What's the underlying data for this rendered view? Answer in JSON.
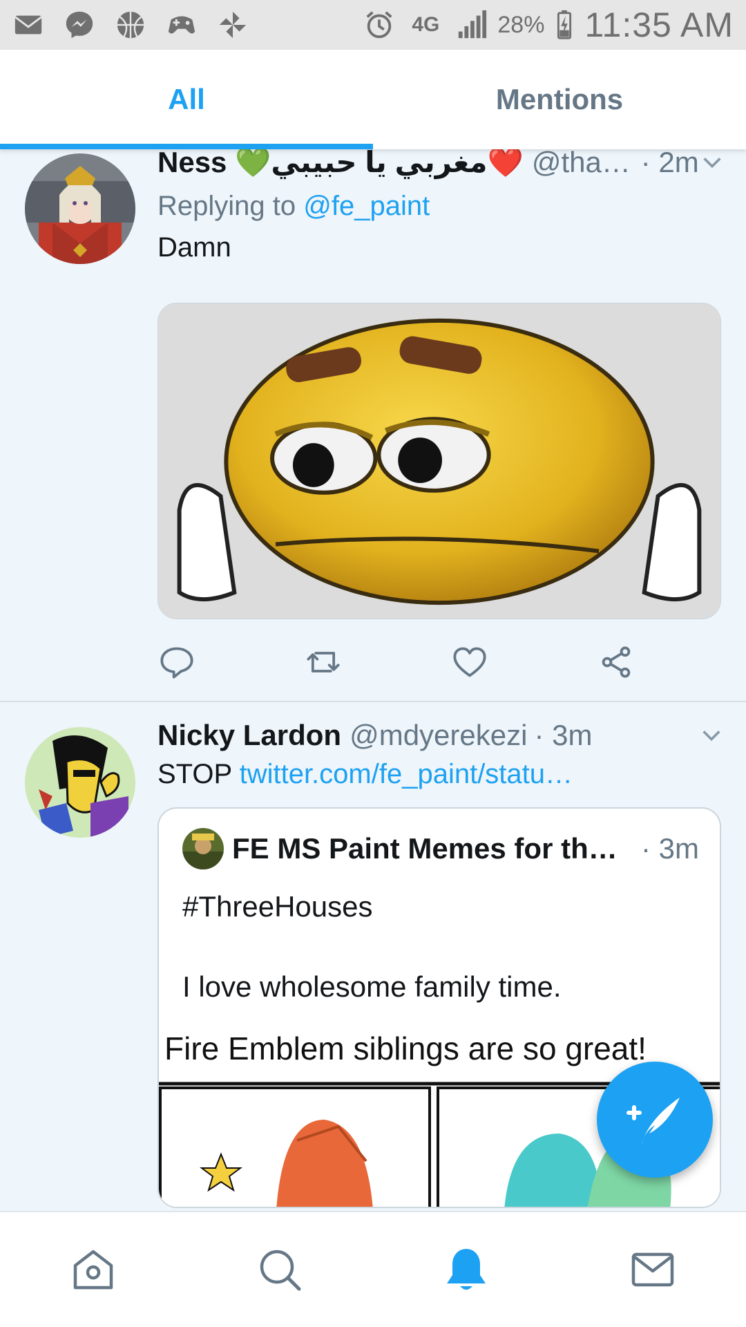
{
  "status_bar": {
    "left_icons": [
      "mail-icon",
      "messenger-icon",
      "basketball-icon",
      "game-controller-icon",
      "pinwheel-icon"
    ],
    "network": "4G",
    "battery_pct": "28%",
    "time": "11:35 AM"
  },
  "tabs": [
    {
      "label": "All",
      "active": true
    },
    {
      "label": "Mentions",
      "active": false
    }
  ],
  "tweets": [
    {
      "name": "Ness 💚مغربي يا حبيبي❤️",
      "handle": "@that…",
      "time": "· 2m",
      "replying_prefix": "Replying to ",
      "replying_to": "@fe_paint",
      "text": "Damn"
    },
    {
      "name": "Nicky Lardon",
      "handle": "@mdyerekezi",
      "time": "· 3m",
      "text": "STOP ",
      "link": "twitter.com/fe_paint/statu…",
      "quote": {
        "name": "FE MS Paint Memes for th…",
        "time": "· 3m",
        "line1": "#ThreeHouses",
        "line2": "I love wholesome family time.",
        "image_caption": "Fire Emblem siblings are so great!"
      }
    }
  ],
  "colors": {
    "accent": "#1da1f2",
    "muted": "#657786",
    "feed_bg": "#eef5fb"
  },
  "bottom_nav": [
    "home-icon",
    "search-icon",
    "notifications-icon",
    "messages-icon"
  ]
}
